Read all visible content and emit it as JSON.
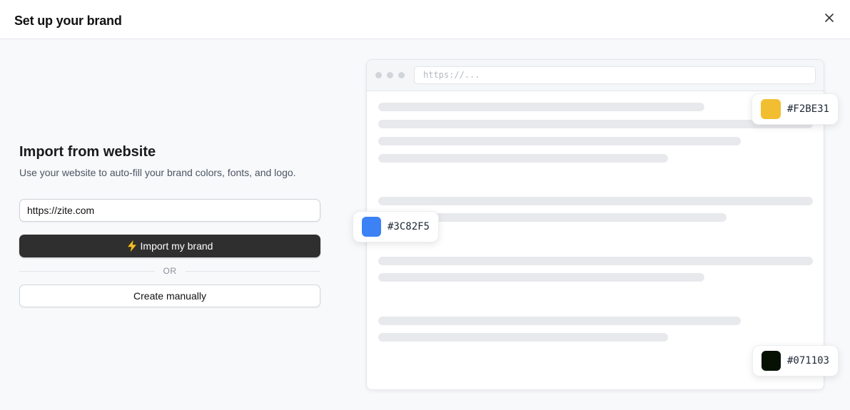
{
  "header": {
    "title": "Set up your brand"
  },
  "import": {
    "title": "Import from website",
    "description": "Use your website to auto-fill your brand colors, fonts, and logo.",
    "url_value": "https://zite.com",
    "import_label": "Import my brand",
    "or_label": "OR",
    "create_label": "Create manually"
  },
  "preview": {
    "address_placeholder": "https://...",
    "swatches": [
      {
        "label": "#F2BE31",
        "color": "#F2BE31"
      },
      {
        "label": "#3C82F5",
        "color": "#3C82F5"
      },
      {
        "label": "#071103",
        "color": "#071103"
      }
    ]
  },
  "icons": {
    "close": "close-icon",
    "import": "lightning-bolt-icon"
  }
}
